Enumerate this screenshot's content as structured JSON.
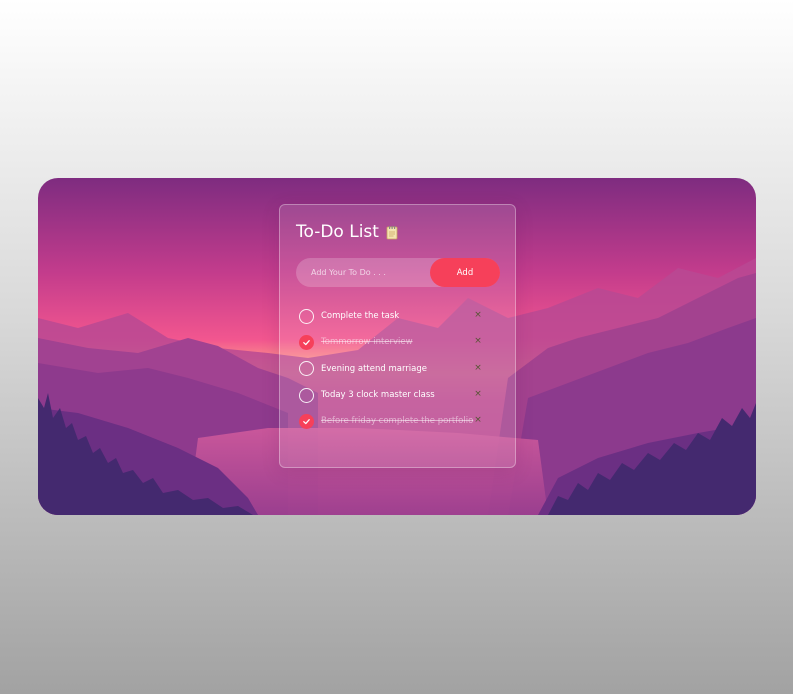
{
  "app": {
    "title": "To-Do List",
    "title_icon": "notepad-icon"
  },
  "input": {
    "placeholder": "Add Your To Do . . .",
    "value": ""
  },
  "add_button": {
    "label": "Add"
  },
  "tasks": [
    {
      "text": "Complete the task",
      "done": false
    },
    {
      "text": "Tommorrow interview",
      "done": true
    },
    {
      "text": "Evening attend marriage",
      "done": false
    },
    {
      "text": "Today 3 clock master class",
      "done": false
    },
    {
      "text": "Before friday complete the portfolio",
      "done": true
    }
  ],
  "remove_glyph": "×",
  "colors": {
    "accent": "#f6405a",
    "sky_top": "#8a2f82",
    "sky_horizon": "#f25a93",
    "mountains": "#7a2d8c",
    "trees": "#3f2a6d"
  }
}
